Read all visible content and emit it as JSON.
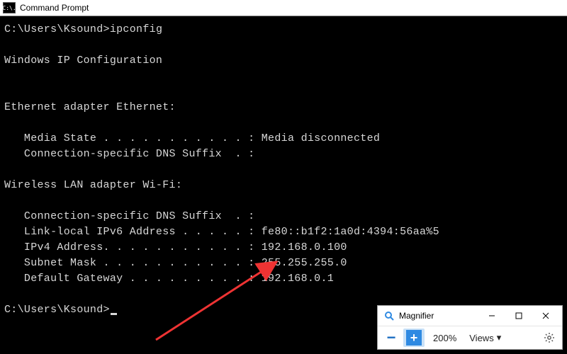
{
  "window": {
    "title": "Command Prompt",
    "icon_label": "C:\\."
  },
  "terminal": {
    "prompt1": "C:\\Users\\Ksound>",
    "cmd": "ipconfig",
    "header": "Windows IP Configuration",
    "eth_header": "Ethernet adapter Ethernet:",
    "eth_media": "   Media State . . . . . . . . . . . : Media disconnected",
    "eth_dns": "   Connection-specific DNS Suffix  . :",
    "wifi_header": "Wireless LAN adapter Wi-Fi:",
    "wifi_dns": "   Connection-specific DNS Suffix  . :",
    "wifi_ipv6": "   Link-local IPv6 Address . . . . . : fe80::b1f2:1a0d:4394:56aa%5",
    "wifi_ipv4": "   IPv4 Address. . . . . . . . . . . : 192.168.0.100",
    "wifi_mask": "   Subnet Mask . . . . . . . . . . . : 255.255.255.0",
    "wifi_gw": "   Default Gateway . . . . . . . . . : 192.168.0.1",
    "prompt2": "C:\\Users\\Ksound>"
  },
  "magnifier": {
    "title": "Magnifier",
    "zoom": "200%",
    "views": "Views",
    "icons": {
      "minimize": "minimize-icon",
      "maximize": "maximize-icon",
      "close": "close-icon",
      "minus": "zoom-out-icon",
      "plus": "zoom-in-icon",
      "chevron": "chevron-down-icon",
      "gear": "gear-icon",
      "app": "magnifier-icon"
    }
  }
}
